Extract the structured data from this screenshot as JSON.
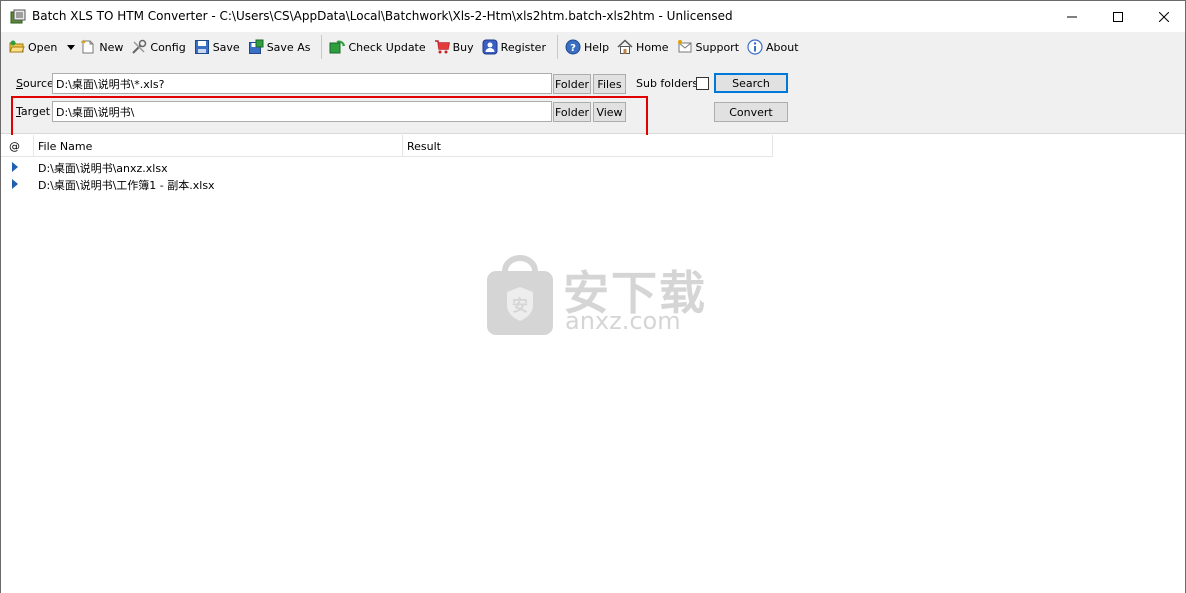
{
  "window": {
    "title": "Batch XLS TO HTM Converter - C:\\Users\\CS\\AppData\\Local\\Batchwork\\Xls-2-Htm\\xls2htm.batch-xls2htm - Unlicensed"
  },
  "toolbar": {
    "open": "Open",
    "new": "New",
    "config": "Config",
    "save": "Save",
    "save_as": "Save As",
    "check_update": "Check Update",
    "buy": "Buy",
    "register": "Register",
    "help": "Help",
    "home": "Home",
    "support": "Support",
    "about": "About"
  },
  "form": {
    "source_label_accel": "S",
    "source_label_rest": "ource",
    "source_value": "D:\\桌面\\说明书\\*.xls?",
    "source_folder_button": "Folder",
    "source_files_button": "Files",
    "sub_folders_label": "Sub folders",
    "sub_folders_checked": false,
    "search_button": "Search",
    "target_label_accel": "T",
    "target_label_rest": "arget",
    "target_value": "D:\\桌面\\说明书\\",
    "target_folder_button": "Folder",
    "target_view_button": "View",
    "convert_button": "Convert"
  },
  "list": {
    "columns": [
      "@",
      "File Name",
      "Result"
    ],
    "rows": [
      {
        "file_name": "D:\\桌面\\说明书\\anxz.xlsx",
        "result": ""
      },
      {
        "file_name": "D:\\桌面\\说明书\\工作簿1 - 副本.xlsx",
        "result": ""
      }
    ]
  },
  "watermark": {
    "cn": "安下载",
    "en": "anxz.com"
  },
  "colors": {
    "highlight": "#e00000",
    "toolbar_bg": "#f0f0f0",
    "accent": "#0078d7"
  }
}
